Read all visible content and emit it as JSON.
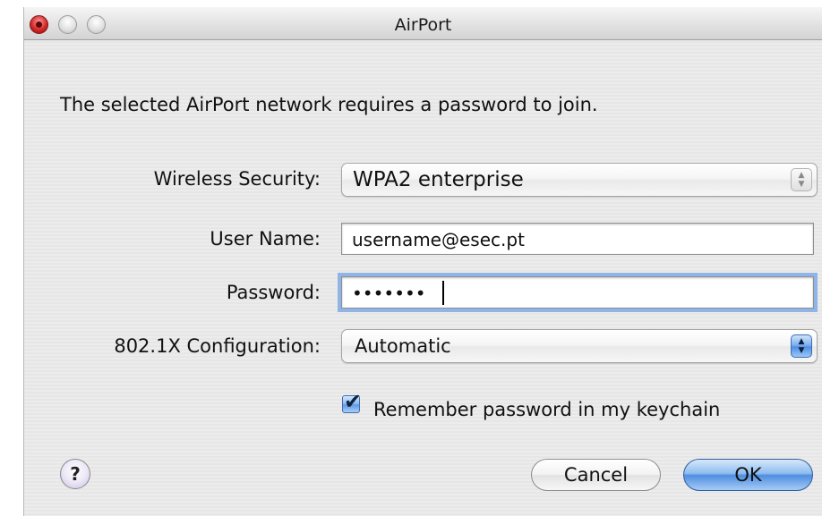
{
  "window": {
    "title": "AirPort"
  },
  "dialog": {
    "prompt": "The selected AirPort network requires a password to join.",
    "wireless_security": {
      "label": "Wireless Security:",
      "value": "WPA2 enterprise"
    },
    "user_name": {
      "label": "User Name:",
      "value": "username@esec.pt"
    },
    "password": {
      "label": "Password:",
      "masked_value": "•••••••"
    },
    "configuration": {
      "label": "802.1X Configuration:",
      "value": "Automatic"
    },
    "remember": {
      "label": "Remember password in my keychain",
      "checked": true,
      "check_mark": "✔"
    },
    "help_label": "?",
    "cancel_label": "Cancel",
    "ok_label": "OK"
  },
  "icons": {
    "close": "close-icon",
    "minimize": "minimize-icon",
    "zoom": "zoom-icon",
    "stepper": "up-down-arrows-icon",
    "help": "question-mark-icon",
    "checkmark": "checkmark-icon"
  },
  "colors": {
    "accent": "#5d98e4",
    "close_button": "#d62828",
    "background": "#ececec"
  }
}
